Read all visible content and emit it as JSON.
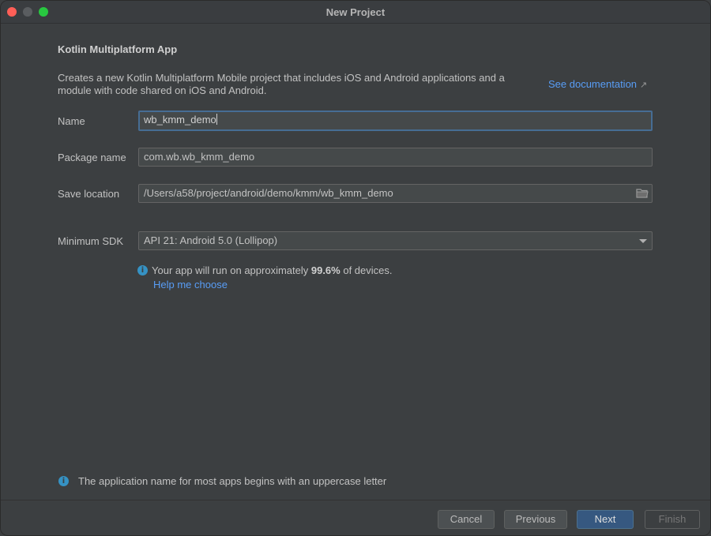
{
  "window": {
    "title": "New Project"
  },
  "page": {
    "heading": "Kotlin Multiplatform App",
    "description": "Creates a new Kotlin Multiplatform Mobile project that includes iOS and Android applications and a module with code shared on iOS and Android.",
    "doc_link": "See documentation",
    "doc_link_arrow": "↗"
  },
  "form": {
    "name_label": "Name",
    "name_value": "wb_kmm_demo",
    "package_label": "Package name",
    "package_value": "com.wb.wb_kmm_demo",
    "location_label": "Save location",
    "location_value": "/Users/a58/project/android/demo/kmm/wb_kmm_demo",
    "sdk_label": "Minimum SDK",
    "sdk_value": "API 21: Android 5.0 (Lollipop)"
  },
  "sdk_info": {
    "prefix": "Your app will run on approximately ",
    "percent": "99.6%",
    "suffix": " of devices.",
    "help_link": "Help me choose"
  },
  "hint": "The application name for most apps begins with an uppercase letter",
  "buttons": {
    "cancel": "Cancel",
    "previous": "Previous",
    "next": "Next",
    "finish": "Finish"
  },
  "icons": {
    "info": "info-icon",
    "folder": "folder-icon",
    "dropdown": "chevron-down-icon"
  },
  "colors": {
    "accent_link": "#589df6",
    "primary_button": "#365880",
    "focus_border": "#466d94",
    "info_icon": "#3592c4"
  }
}
